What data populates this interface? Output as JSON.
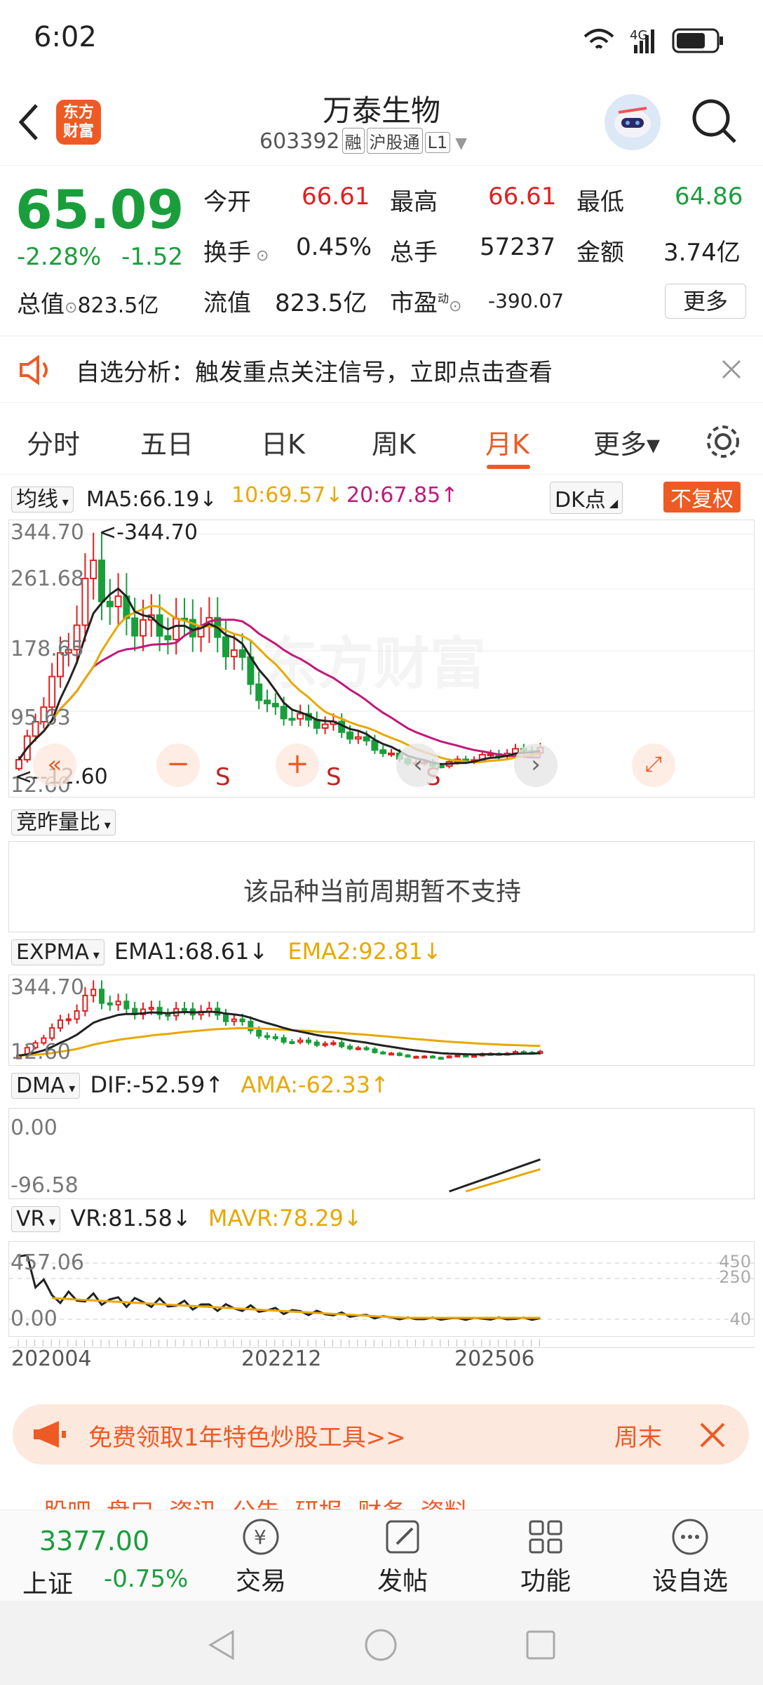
{
  "status": {
    "time": "6:02",
    "network": "4G"
  },
  "header": {
    "logo": "东方\n财富",
    "title": "万泰生物",
    "code": "603392",
    "tags": [
      "融",
      "沪股通",
      "L1"
    ]
  },
  "quote": {
    "price": "65.09",
    "change_pct": "-2.28%",
    "change": "-1.52",
    "fields": [
      {
        "k": "今开",
        "v": "66.61"
      },
      {
        "k": "最高",
        "v": "66.61"
      },
      {
        "k": "最低",
        "v": "64.86"
      },
      {
        "k": "换手",
        "v": "0.45%"
      },
      {
        "k": "总手",
        "v": "57237"
      },
      {
        "k": "金额",
        "v": "3.74亿"
      },
      {
        "k": "总值",
        "v": "823.5亿"
      },
      {
        "k": "流值",
        "v": "823.5亿"
      },
      {
        "k": "市盈",
        "v": "-390.07"
      }
    ],
    "pe_sup": "动",
    "more_label": "更多"
  },
  "notice": {
    "text": "自选分析：触发重点关注信号，立即点击查看"
  },
  "tabs": [
    "分时",
    "五日",
    "日K",
    "周K",
    "月K",
    "更多▾"
  ],
  "main_chart": {
    "ma_select": "均线",
    "ma5": "MA5:66.19↓",
    "ma10": "10:69.57↓",
    "ma20": "20:67.85↑",
    "dk": "DK点",
    "adjust": "不复权",
    "y_labels": [
      "344.70",
      "261.68",
      "178.65",
      "95.63",
      "12.60"
    ],
    "max_label": "<-344.70",
    "min_label": "<--12.60",
    "watermark": "东方财富",
    "sell_marks": [
      "S",
      "S",
      "S"
    ]
  },
  "auction": {
    "select": "竞昨量比",
    "message": "该品种当前周期暂不支持"
  },
  "expma": {
    "select": "EXPMA",
    "ema1": "EMA1:68.61↓",
    "ema2": "EMA2:92.81↓",
    "y_labels": [
      "344.70",
      "12.60"
    ]
  },
  "dma": {
    "select": "DMA",
    "dif": "DIF:-52.59↑",
    "ama": "AMA:-62.33↑",
    "y_labels": [
      "0.00",
      "-96.58"
    ]
  },
  "vr": {
    "select": "VR",
    "vr": "VR:81.58↓",
    "mavr": "MAVR:78.29↓",
    "y_labels": [
      "457.06",
      "0.00"
    ],
    "right_labels": [
      "450",
      "250",
      "40"
    ]
  },
  "x_labels": [
    "202004",
    "202212",
    "202506"
  ],
  "banner": {
    "text": "免费领取1年特色炒股工具>>",
    "right": "周末"
  },
  "lower_tabs": "股吧  盘口  资讯  公告  研报  财务  资料",
  "bottom": {
    "index_value": "3377.00",
    "index_name": "上证",
    "index_change": "-0.75%",
    "items": [
      "交易",
      "发帖",
      "功能",
      "设自选"
    ]
  },
  "colors": {
    "up": "#e02020",
    "down": "#1a9e3c",
    "accent": "#ee5a24",
    "ma5": "#222222",
    "ma10": "#e8a800",
    "ma20": "#c2187a"
  }
}
